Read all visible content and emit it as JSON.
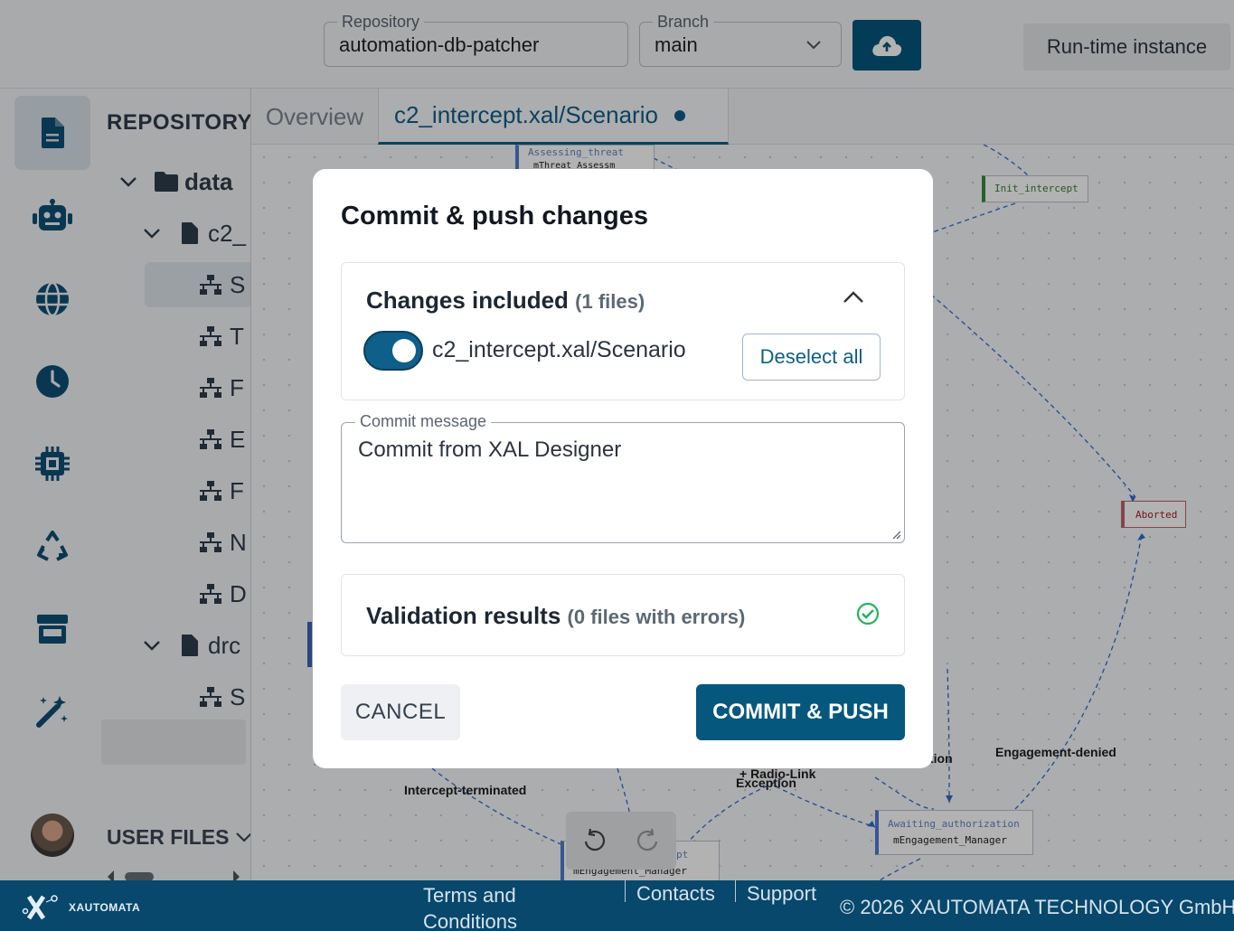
{
  "header": {
    "repository_legend": "Repository",
    "repository_value": "automation-db-patcher",
    "branch_legend": "Branch",
    "branch_value": "main",
    "runtime_label": "Run-time instance"
  },
  "sidebar": {
    "icons": [
      "file-icon",
      "robot-icon",
      "globe-icon",
      "clock-icon",
      "chip-icon",
      "recycle-icon",
      "store-icon",
      "magic-wand-icon"
    ]
  },
  "tree": {
    "title": "REPOSITORY",
    "folder": "data",
    "file1": "c2_",
    "items": [
      "S",
      "T",
      "F",
      "E",
      "F",
      "N",
      "D"
    ],
    "file2": "drc",
    "file2_items": [
      "S"
    ],
    "user_files": "USER FILES"
  },
  "tabs": {
    "overview": "Overview",
    "active": "c2_intercept.xal/Scenario"
  },
  "canvas": {
    "nodes": {
      "assessing": "Assessing_threat",
      "assessing_sub": "mThreat_Assessm",
      "init": "Init_intercept",
      "aborted": "Aborted",
      "awaiting": "Awaiting_authorization",
      "awaiting_sub": "mEngagement_Manager",
      "bottom_sub": "mEngagement_Manager",
      "bottom_title": "pt"
    },
    "edge_labels": {
      "intercept_terminated": "Intercept-terminated",
      "radio_link": "+ Radio-Link",
      "exception": "Exception",
      "tion": "tion",
      "engagement_denied": "Engagement-denied"
    }
  },
  "modal": {
    "title": "Commit & push changes",
    "changes_heading": "Changes included",
    "changes_count": "(1 files)",
    "file": "c2_intercept.xal/Scenario",
    "deselect_label": "Deselect all",
    "message_legend": "Commit message",
    "message_value": "Commit from XAL Designer",
    "validation_heading": "Validation results",
    "validation_count": "(0 files with errors)",
    "cancel_label": "CANCEL",
    "commit_label": "COMMIT & PUSH"
  },
  "footer": {
    "logo_text": "XAUTOMATA",
    "terms": "Terms and Conditions",
    "contacts": "Contacts",
    "support": "Support",
    "copyright": "© 2026 XAUTOMATA TECHNOLOGY GmbH"
  },
  "colors": {
    "primary": "#05577d",
    "accent": "#0e5f8a",
    "success": "#22b35a",
    "aborted": "#a3212c",
    "init": "#3a8a3a"
  }
}
